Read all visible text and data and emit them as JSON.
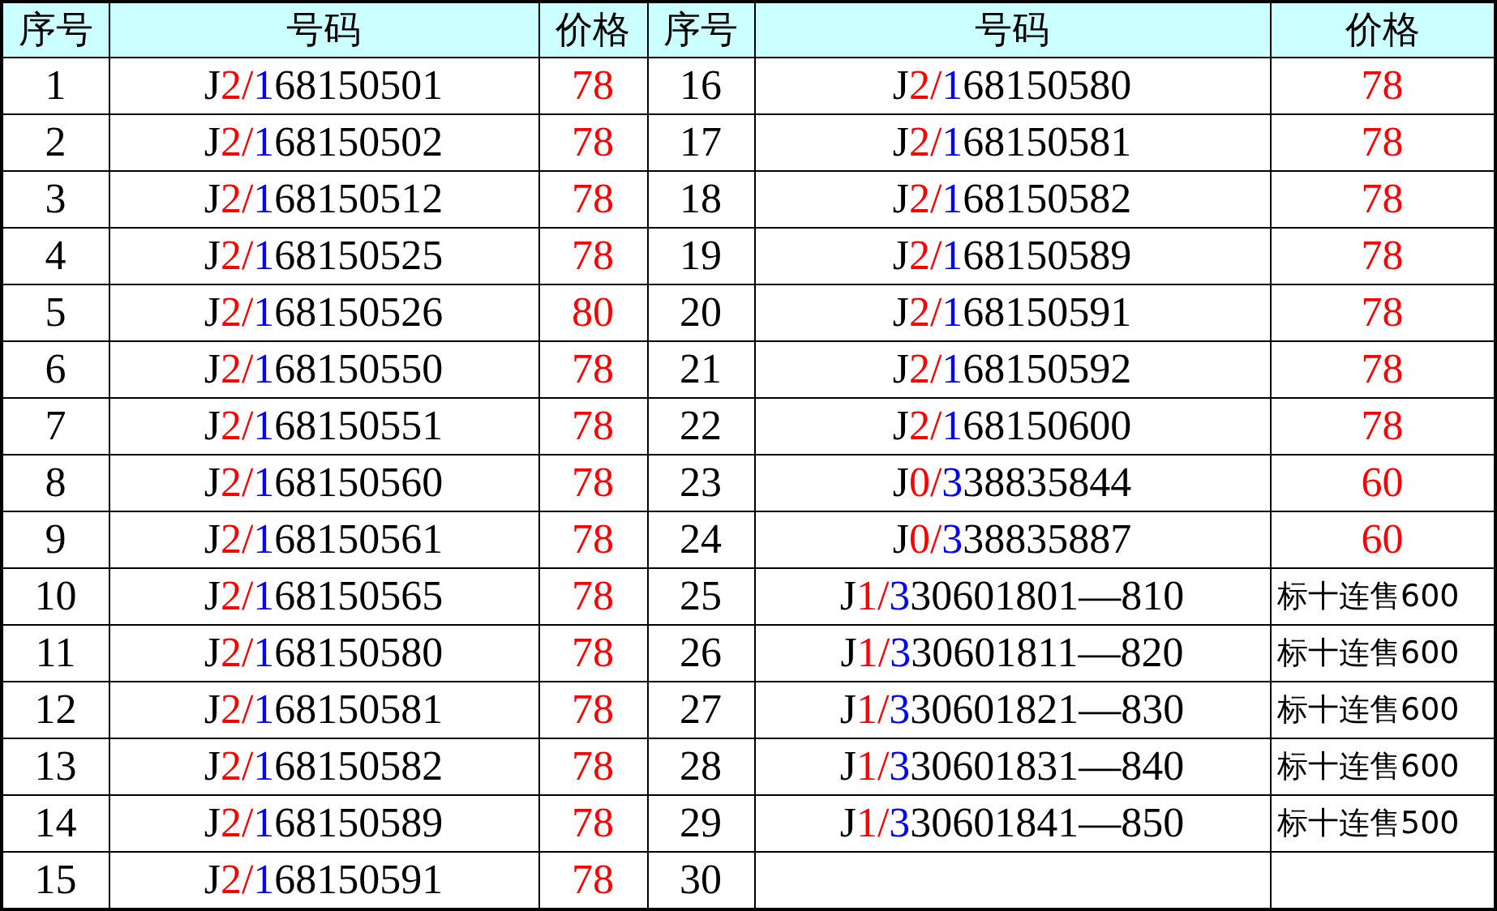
{
  "columns": [
    "序号",
    "号码",
    "价格",
    "序号",
    "号码",
    "价格"
  ],
  "left": [
    {
      "index": "1",
      "code": "J2/168150501",
      "price": {
        "kind": "number",
        "text": "78"
      }
    },
    {
      "index": "2",
      "code": "J2/168150502",
      "price": {
        "kind": "number",
        "text": "78"
      }
    },
    {
      "index": "3",
      "code": "J2/168150512",
      "price": {
        "kind": "number",
        "text": "78"
      }
    },
    {
      "index": "4",
      "code": "J2/168150525",
      "price": {
        "kind": "number",
        "text": "78"
      }
    },
    {
      "index": "5",
      "code": "J2/168150526",
      "price": {
        "kind": "number",
        "text": "80"
      }
    },
    {
      "index": "6",
      "code": "J2/168150550",
      "price": {
        "kind": "number",
        "text": "78"
      }
    },
    {
      "index": "7",
      "code": "J2/168150551",
      "price": {
        "kind": "number",
        "text": "78"
      }
    },
    {
      "index": "8",
      "code": "J2/168150560",
      "price": {
        "kind": "number",
        "text": "78"
      }
    },
    {
      "index": "9",
      "code": "J2/168150561",
      "price": {
        "kind": "number",
        "text": "78"
      }
    },
    {
      "index": "10",
      "code": "J2/168150565",
      "price": {
        "kind": "number",
        "text": "78"
      }
    },
    {
      "index": "11",
      "code": "J2/168150580",
      "price": {
        "kind": "number",
        "text": "78"
      }
    },
    {
      "index": "12",
      "code": "J2/168150581",
      "price": {
        "kind": "number",
        "text": "78"
      }
    },
    {
      "index": "13",
      "code": "J2/168150582",
      "price": {
        "kind": "number",
        "text": "78"
      }
    },
    {
      "index": "14",
      "code": "J2/168150589",
      "price": {
        "kind": "number",
        "text": "78"
      }
    },
    {
      "index": "15",
      "code": "J2/168150591",
      "price": {
        "kind": "number",
        "text": "78"
      }
    }
  ],
  "right": [
    {
      "index": "16",
      "code": "J2/168150580",
      "price": {
        "kind": "number",
        "text": "78"
      }
    },
    {
      "index": "17",
      "code": "J2/168150581",
      "price": {
        "kind": "number",
        "text": "78"
      }
    },
    {
      "index": "18",
      "code": "J2/168150582",
      "price": {
        "kind": "number",
        "text": "78"
      }
    },
    {
      "index": "19",
      "code": "J2/168150589",
      "price": {
        "kind": "number",
        "text": "78"
      }
    },
    {
      "index": "20",
      "code": "J2/168150591",
      "price": {
        "kind": "number",
        "text": "78"
      }
    },
    {
      "index": "21",
      "code": "J2/168150592",
      "price": {
        "kind": "number",
        "text": "78"
      }
    },
    {
      "index": "22",
      "code": "J2/168150600",
      "price": {
        "kind": "number",
        "text": "78"
      }
    },
    {
      "index": "23",
      "code": "J0/338835844",
      "price": {
        "kind": "number",
        "text": "60"
      }
    },
    {
      "index": "24",
      "code": "J0/338835887",
      "price": {
        "kind": "number",
        "text": "60"
      }
    },
    {
      "index": "25",
      "code": "J1/330601801—810",
      "price": {
        "kind": "note",
        "text": "标十连售600"
      }
    },
    {
      "index": "26",
      "code": "J1/330601811—820",
      "price": {
        "kind": "note",
        "text": "标十连售600"
      }
    },
    {
      "index": "27",
      "code": "J1/330601821—830",
      "price": {
        "kind": "note",
        "text": "标十连售600"
      }
    },
    {
      "index": "28",
      "code": "J1/330601831—840",
      "price": {
        "kind": "note",
        "text": "标十连售600"
      }
    },
    {
      "index": "29",
      "code": "J1/330601841—850",
      "price": {
        "kind": "note",
        "text": "标十连售500"
      }
    },
    {
      "index": "30"
    }
  ]
}
